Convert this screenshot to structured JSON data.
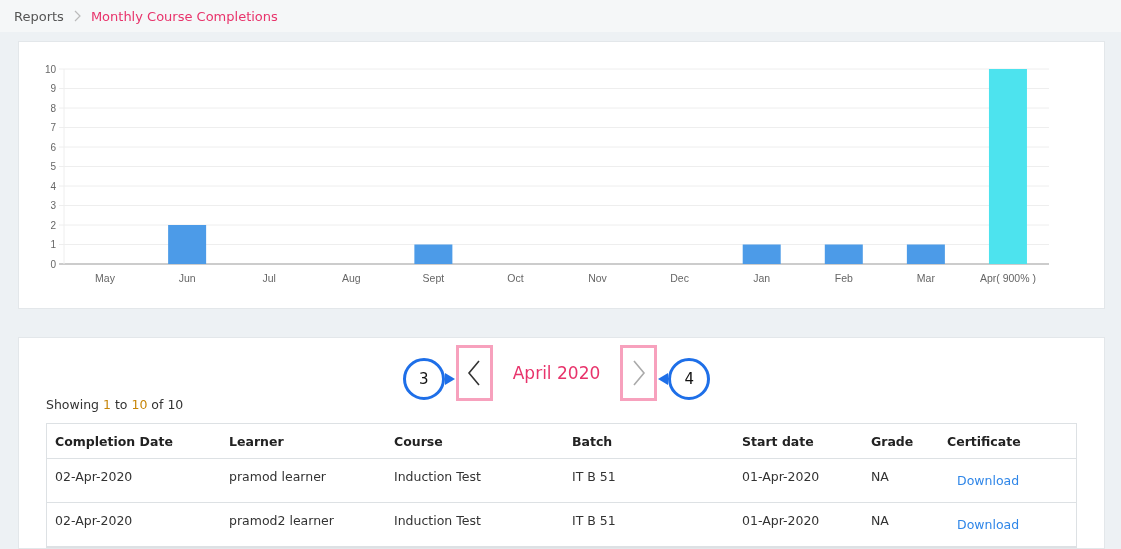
{
  "breadcrumb": [
    {
      "label": "Reports",
      "current": false
    },
    {
      "label": "Monthly Course Completions",
      "current": true
    }
  ],
  "chart": {
    "chart_data": {
      "type": "bar",
      "categories": [
        "May",
        "Jun",
        "Jul",
        "Aug",
        "Sept",
        "Oct",
        "Nov",
        "Dec",
        "Jan",
        "Feb",
        "Mar",
        "Apr( 900% )"
      ],
      "stacked": true,
      "grid": true,
      "ylim": [
        0,
        10
      ],
      "yticks": [
        0,
        1,
        2,
        3,
        4,
        5,
        6,
        7,
        8,
        9,
        10
      ],
      "series": [
        {
          "color": "#4c9be8",
          "values": [
            0,
            2,
            0,
            0,
            1,
            0,
            0,
            0,
            1,
            1,
            1,
            null
          ]
        },
        {
          "color": "#4de3ee",
          "values": [
            null,
            null,
            null,
            null,
            null,
            null,
            null,
            null,
            null,
            null,
            null,
            10
          ]
        }
      ]
    }
  },
  "period": {
    "label": "April 2020",
    "prev": {
      "disabled": false,
      "callout": "3"
    },
    "next": {
      "disabled": true,
      "callout": "4"
    }
  },
  "showing": [
    {
      "text": "Showing ",
      "highlight": false
    },
    {
      "text": "1",
      "highlight": true
    },
    {
      "text": " to ",
      "highlight": false
    },
    {
      "text": "10",
      "highlight": true
    },
    {
      "text": " of 10",
      "highlight": false
    }
  ],
  "table": {
    "columns": [
      "Completion Date",
      "Learner",
      "Course",
      "Batch",
      "Start date",
      "Grade",
      "Certificate"
    ],
    "rows": [
      [
        "02-Apr-2020",
        "pramod learner",
        "Induction Test",
        "IT B 51",
        "01-Apr-2020",
        "NA",
        "Download"
      ],
      [
        "02-Apr-2020",
        "pramod2 learner",
        "Induction Test",
        "IT B 51",
        "01-Apr-2020",
        "NA",
        "Download"
      ]
    ]
  }
}
